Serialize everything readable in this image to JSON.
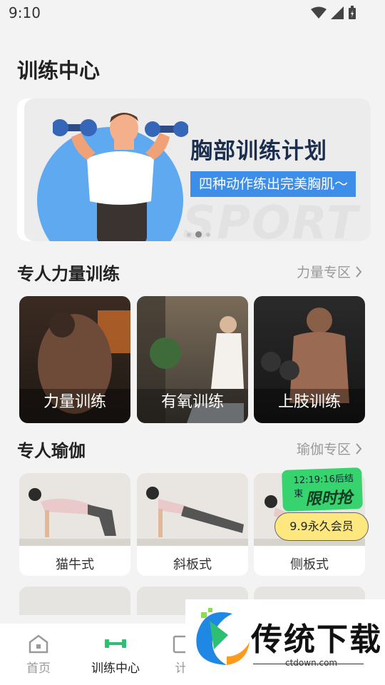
{
  "status_bar": {
    "time": "9:10"
  },
  "page": {
    "title": "训练中心"
  },
  "banner": {
    "title": "胸部训练计划",
    "subtitle": "四种动作练出完美胸肌～",
    "bg_text": "SPORT",
    "dots": 3,
    "active_dot": 1
  },
  "strength": {
    "title": "专人力量训练",
    "link": "力量专区",
    "cards": [
      {
        "label": "力量训练"
      },
      {
        "label": "有氧训练"
      },
      {
        "label": "上肢训练"
      }
    ]
  },
  "yoga": {
    "title": "专人瑜伽",
    "link": "瑜伽专区",
    "cards": [
      {
        "label": "猫牛式"
      },
      {
        "label": "斜板式"
      },
      {
        "label": "侧板式"
      }
    ]
  },
  "promo": {
    "timer": "12:19:16后结束",
    "flash": "限时抢",
    "offer": "9.9永久会员"
  },
  "bottom_nav": {
    "items": [
      {
        "label": "首页",
        "icon": "home-icon"
      },
      {
        "label": "训练中心",
        "icon": "dumbbell-icon"
      },
      {
        "label": "计",
        "icon": "plan-icon"
      }
    ]
  },
  "watermark": {
    "text": "传统下载",
    "url": "ctdown.com"
  },
  "colors": {
    "accent_green": "#2fbf73",
    "banner_blue": "#3d8ee8",
    "promo_green": "#37d36f",
    "promo_yellow": "#fde880"
  }
}
